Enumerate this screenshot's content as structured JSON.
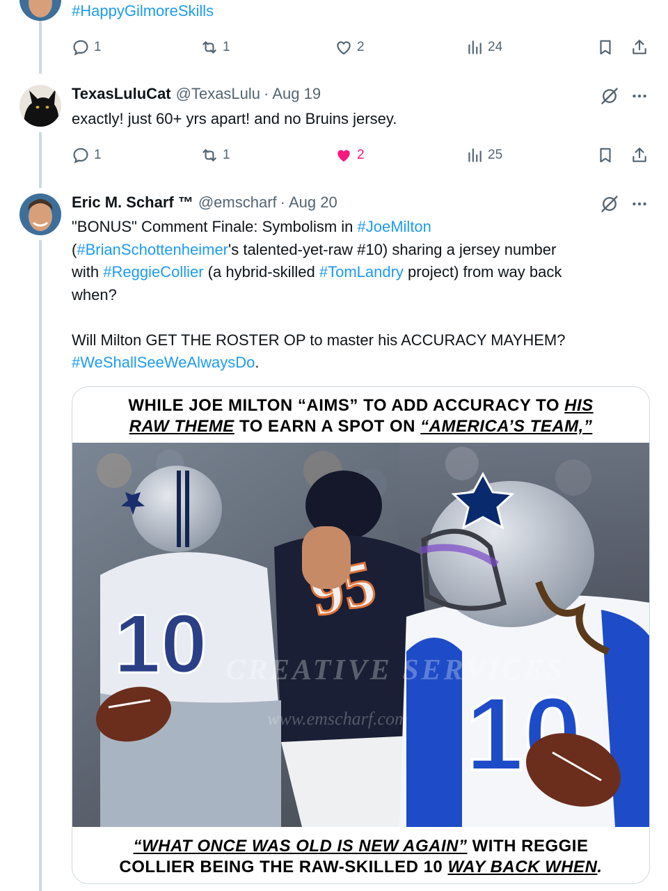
{
  "tweets": [
    {
      "text": "#HappyGilmoreSkills",
      "replies": "1",
      "reposts": "1",
      "likes": "2",
      "views": "24",
      "liked": false
    },
    {
      "name": "TexasLuluCat",
      "handle": "@TexasLulu",
      "date": "Aug 19",
      "text": "exactly!  just 60+ yrs apart!  and no Bruins jersey.",
      "replies": "1",
      "reposts": "1",
      "likes": "2",
      "views": "25",
      "liked": true
    },
    {
      "name": "Eric M. Scharf ™",
      "handle": "@emscharf",
      "date": "Aug 20",
      "body": {
        "p1_a": "\"BONUS\" Comment Finale: Symbolism in ",
        "tag_joe": "#JoeMilton",
        "p1_b": "(",
        "tag_brian": "#BrianSchottenheimer",
        "p1_c": "'s talented-yet-raw #10) sharing a jersey number",
        "p1_d": "with ",
        "tag_reggie": "#ReggieCollier",
        "p1_e": " (a hybrid-skilled ",
        "tag_tom": "#TomLandry",
        "p1_f": " project) from way back",
        "p1_g": "when?",
        "p2": "Will Milton GET THE ROSTER OP to master his ACCURACY MAYHEM?",
        "tag_see": "#WeShallSeeWeAlwaysDo",
        "p2_end": "."
      },
      "image": {
        "top_l1_a": "WHILE JOE MILTON “AIMS” TO ADD ACCURACY TO ",
        "top_l1_b": "HIS",
        "top_l2_a": "RAW THEME",
        "top_l2_b": " TO EARN A SPOT ON ",
        "top_l2_c": "“AMERICA’S TEAM,”",
        "bottom_l1_a": "“WHAT ONCE WAS OLD IS NEW AGAIN”",
        "bottom_l1_b": " WITH REGGIE",
        "bottom_l2_a": "COLLIER BEING THE RAW-SKILLED 10 ",
        "bottom_l2_b": "WAY BACK WHEN",
        "bottom_l2_c": ".",
        "jersey_number": "10",
        "opponent_number": "95",
        "watermark_1": "CREATIVE SERVICES",
        "watermark_2": "www.emscharf.com"
      }
    }
  ],
  "colors": {
    "accent": "#1d9bf0",
    "muted": "#536471",
    "like": "#f91880",
    "thread_line": "#cfd9de",
    "cowboys_blue": "#1e4cc8",
    "bears_navy": "#1a1f35"
  },
  "icons": [
    "reply-icon",
    "repost-icon",
    "like-icon",
    "views-icon",
    "bookmark-icon",
    "share-icon",
    "grok-icon",
    "more-icon"
  ]
}
